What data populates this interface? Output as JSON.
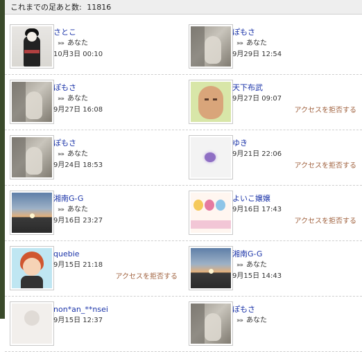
{
  "header": {
    "label": "これまでの足あと数:",
    "count": "11816"
  },
  "deny_label": "アクセスを拒否する",
  "you_arrow": "»»",
  "visits": [
    {
      "name": "さとこ",
      "you": "あなた",
      "date": "10月3日 00:10",
      "pic": "geisha",
      "deny": false
    },
    {
      "name": "ぽもさ",
      "you": "あなた",
      "date": "9月29日 12:54",
      "pic": "cat",
      "deny": false
    },
    {
      "name": "ぽもさ",
      "you": "あなた",
      "date": "9月27日 16:08",
      "pic": "cat",
      "deny": false
    },
    {
      "name": "天下布武",
      "you": "",
      "date": "9月27日 09:07",
      "pic": "bald",
      "deny": true
    },
    {
      "name": "ぽもさ",
      "you": "あなた",
      "date": "9月24日 18:53",
      "pic": "cat",
      "deny": false
    },
    {
      "name": "ゆき",
      "you": "",
      "date": "9月21日 22:06",
      "pic": "purple",
      "deny": true
    },
    {
      "name": "湘南G-G",
      "you": "あなた",
      "date": "9月16日 23:27",
      "pic": "sunset",
      "deny": false
    },
    {
      "name": "よいこ嬢嬢",
      "you": "",
      "date": "9月16日 17:43",
      "pic": "anime",
      "deny": true
    },
    {
      "name": "quebie",
      "you": "",
      "date": "9月15日 21:18",
      "pic": "avatar",
      "deny": true
    },
    {
      "name": "湘南G-G",
      "you": "あなた",
      "date": "9月15日 14:43",
      "pic": "sunset",
      "deny": false
    },
    {
      "name": "non*an_**nsei",
      "you": "",
      "date": "9月15日 12:37",
      "pic": "blank",
      "deny": false
    },
    {
      "name": "ぽもさ",
      "you": "あなた",
      "date": "",
      "pic": "cat",
      "deny": false
    }
  ]
}
